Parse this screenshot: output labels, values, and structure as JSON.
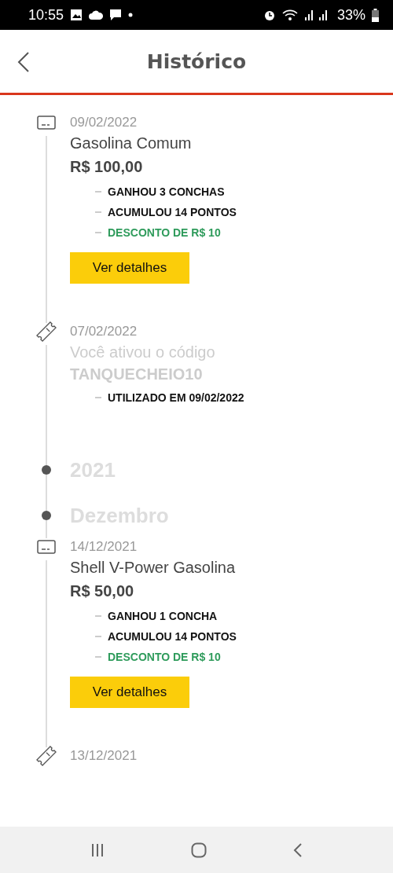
{
  "status_bar": {
    "time": "10:55",
    "battery": "33%"
  },
  "header": {
    "title": "Histórico"
  },
  "timeline": [
    {
      "kind": "purchase",
      "date": "09/02/2022",
      "title": "Gasolina Comum",
      "price": "R$ 100,00",
      "details": [
        {
          "kind": "reward",
          "text": "GANHOU 3 CONCHAS"
        },
        {
          "kind": "reward",
          "text": "ACUMULOU 14 PONTOS"
        },
        {
          "kind": "discount",
          "text": "DESCONTO DE R$ 10"
        }
      ],
      "button": "Ver detalhes"
    },
    {
      "kind": "code",
      "date": "07/02/2022",
      "title": "Você ativou o código",
      "code": "TANQUECHEIO10",
      "details": [
        {
          "kind": "reward",
          "text": "UTILIZADO EM 09/02/2022"
        }
      ]
    },
    {
      "kind": "year",
      "label": "2021"
    },
    {
      "kind": "month",
      "label": "Dezembro"
    },
    {
      "kind": "purchase",
      "date": "14/12/2021",
      "title": "Shell V-Power Gasolina",
      "price": "R$ 50,00",
      "details": [
        {
          "kind": "reward",
          "text": "GANHOU 1 CONCHA"
        },
        {
          "kind": "reward",
          "text": "ACUMULOU 14 PONTOS"
        },
        {
          "kind": "discount",
          "text": "DESCONTO DE R$ 10"
        }
      ],
      "button": "Ver detalhes"
    },
    {
      "kind": "code",
      "date": "13/12/2021"
    }
  ]
}
